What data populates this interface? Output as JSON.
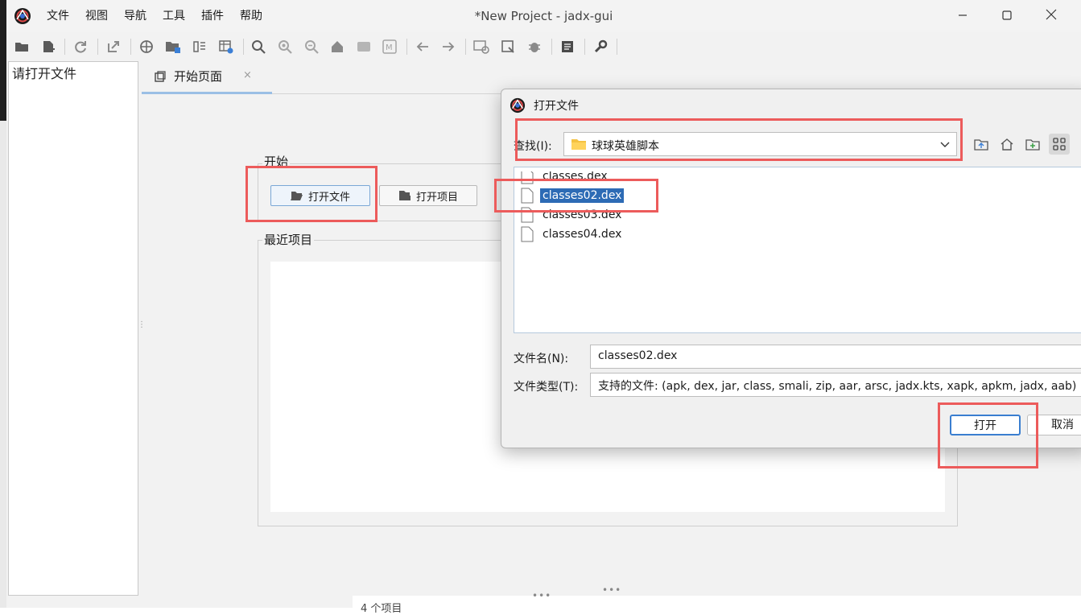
{
  "window": {
    "title": "*New Project - jadx-gui",
    "minimize_icon": "minimize-icon",
    "maximize_icon": "maximize-icon",
    "close_icon": "close-icon"
  },
  "menu": [
    "文件",
    "视图",
    "导航",
    "工具",
    "插件",
    "帮助"
  ],
  "toolbar_icons": [
    "open-file-icon",
    "add-files-icon",
    "reload-icon",
    "export-icon",
    "sync-icon",
    "flatten-packages-icon",
    "split-view-icon",
    "deobf-icon",
    "search-icon",
    "find-class-icon",
    "find-usage-icon",
    "home-icon",
    "log-icon",
    "method-icon",
    "back-icon",
    "forward-icon",
    "decompile-all-icon",
    "quick-search-icon",
    "debug-icon",
    "notes-icon",
    "preferences-icon"
  ],
  "tree": {
    "placeholder": "请打开文件"
  },
  "tab": {
    "label": "开始页面",
    "close": "×"
  },
  "start_page": {
    "start_group": "开始",
    "open_file_button": "打开文件",
    "open_project_button": "打开项目",
    "recent_group": "最近项目"
  },
  "status": {
    "count": "4 个项目"
  },
  "dialog": {
    "title": "打开文件",
    "look_in_label": "查找(I):",
    "look_in_value": "球球英雄脚本",
    "files": [
      "classes.dex",
      "classes02.dex",
      "classes03.dex",
      "classes04.dex"
    ],
    "selected_file": "classes02.dex",
    "file_name_label": "文件名(N):",
    "file_name_value": "classes02.dex",
    "file_type_label": "文件类型(T):",
    "file_type_value": "支持的文件: (apk, dex, jar, class, smali, zip, aar, arsc, jadx.kts, xapk, apkm, jadx, aab)",
    "open_button": "打开",
    "cancel_button": "取消"
  },
  "colors": {
    "highlight": "#ec5b5b",
    "selection": "#2d6bb5",
    "accent": "#3a7ed0"
  }
}
